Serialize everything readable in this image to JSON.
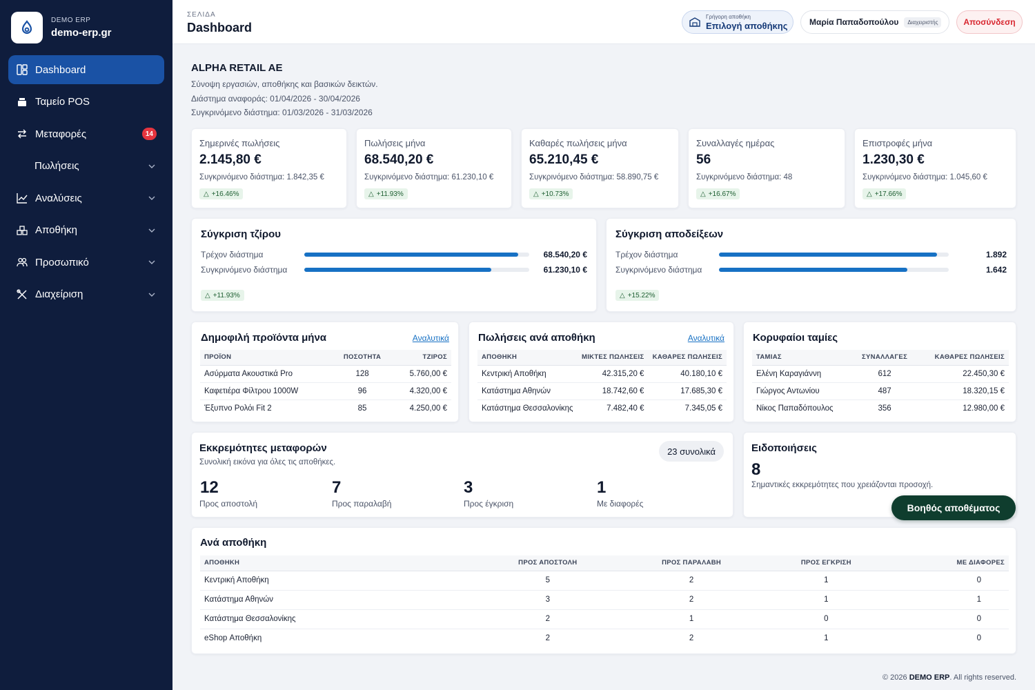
{
  "brand": {
    "small": "DEMO ERP",
    "name": "demo-erp.gr"
  },
  "sidebar": {
    "items": [
      {
        "label": "Dashboard",
        "icon": "dashboard-icon",
        "active": true
      },
      {
        "label": "Ταμείο POS",
        "icon": "cash-register-icon"
      },
      {
        "label": "Μεταφορές",
        "icon": "transfer-icon",
        "badge": "14"
      },
      {
        "label": "Πωλήσεις",
        "icon": "",
        "chevron": true
      },
      {
        "label": "Αναλύσεις",
        "icon": "chart-line-icon",
        "chevron": true
      },
      {
        "label": "Αποθήκη",
        "icon": "boxes-icon",
        "chevron": true
      },
      {
        "label": "Προσωπικό",
        "icon": "people-icon",
        "chevron": true
      },
      {
        "label": "Διαχείριση",
        "icon": "tools-icon",
        "chevron": true
      }
    ]
  },
  "header": {
    "crumb": "ΣΕΛΙΔΑ",
    "title": "Dashboard",
    "warehouse_small": "Γρήγορη αποθήκη",
    "warehouse_big": "Επιλογή αποθήκης",
    "user_name": "Μαρία Παπαδοπούλου",
    "user_role": "Διαχειριστής",
    "logout": "Αποσύνδεση"
  },
  "company": {
    "name": "ALPHA RETAIL AE",
    "subtitle": "Σύνοψη εργασιών, αποθήκης και βασικών δεικτών.",
    "period": "Διάστημα αναφοράς: 01/04/2026 - 30/04/2026",
    "compare": "Συγκρινόμενο διάστημα: 01/03/2026 - 31/03/2026"
  },
  "kpis": [
    {
      "label": "Σημερινές πωλήσεις",
      "value": "2.145,80 €",
      "cmp": "Συγκρινόμενο διάστημα: 1.842,35 €",
      "delta": "+16.46%"
    },
    {
      "label": "Πωλήσεις μήνα",
      "value": "68.540,20 €",
      "cmp": "Συγκρινόμενο διάστημα: 61.230,10 €",
      "delta": "+11.93%"
    },
    {
      "label": "Καθαρές πωλήσεις μήνα",
      "value": "65.210,45 €",
      "cmp": "Συγκρινόμενο διάστημα: 58.890,75 €",
      "delta": "+10.73%"
    },
    {
      "label": "Συναλλαγές ημέρας",
      "value": "56",
      "cmp": "Συγκρινόμενο διάστημα: 48",
      "delta": "+16.67%"
    },
    {
      "label": "Επιστροφές μήνα",
      "value": "1.230,30 €",
      "cmp": "Συγκρινόμενο διάστημα: 1.045,60 €",
      "delta": "+17.66%"
    }
  ],
  "turnover": {
    "title": "Σύγκριση τζίρου",
    "rows": [
      {
        "label": "Τρέχον διάστημα",
        "value": "68.540,20 €",
        "fraction": 0.95
      },
      {
        "label": "Συγκρινόμενο διάστημα",
        "value": "61.230,10 €",
        "fraction": 0.83
      }
    ],
    "delta": "+11.93%"
  },
  "receipts": {
    "title": "Σύγκριση αποδείξεων",
    "rows": [
      {
        "label": "Τρέχον διάστημα",
        "value": "1.892",
        "fraction": 0.95
      },
      {
        "label": "Συγκρινόμενο διάστημα",
        "value": "1.642",
        "fraction": 0.82
      }
    ],
    "delta": "+15.22%"
  },
  "top_products": {
    "title": "Δημοφιλή προϊόντα μήνα",
    "link": "Αναλυτικά",
    "headers": [
      "ΠΡΟΪΟΝ",
      "ΠΟΣΟΤΗΤΑ",
      "ΤΖΙΡΟΣ"
    ],
    "rows": [
      [
        "Ασύρματα Ακουστικά Pro",
        "128",
        "5.760,00 €"
      ],
      [
        "Καφετιέρα Φίλτρου 1000W",
        "96",
        "4.320,00 €"
      ],
      [
        "Έξυπνο Ρολόι Fit 2",
        "85",
        "4.250,00 €"
      ]
    ]
  },
  "sales_by_wh": {
    "title": "Πωλήσεις ανά αποθήκη",
    "link": "Αναλυτικά",
    "headers": [
      "ΑΠΟΘΗΚΗ",
      "ΜΙΚΤΕΣ ΠΩΛΗΣΕΙΣ",
      "ΚΑΘΑΡΕΣ ΠΩΛΗΣΕΙΣ"
    ],
    "rows": [
      [
        "Κεντρική Αποθήκη",
        "42.315,20 €",
        "40.180,10 €"
      ],
      [
        "Κατάστημα Αθηνών",
        "18.742,60 €",
        "17.685,30 €"
      ],
      [
        "Κατάστημα Θεσσαλονίκης",
        "7.482,40 €",
        "7.345,05 €"
      ]
    ]
  },
  "cashiers": {
    "title": "Κορυφαίοι ταμίες",
    "headers": [
      "ΤΑΜΙΑΣ",
      "ΣΥΝΑΛΛΑΓΕΣ",
      "ΚΑΘΑΡΕΣ ΠΩΛΗΣΕΙΣ"
    ],
    "rows": [
      [
        "Ελένη Καραγιάννη",
        "612",
        "22.450,30 €"
      ],
      [
        "Γιώργος Αντωνίου",
        "487",
        "18.320,15 €"
      ],
      [
        "Νίκος Παπαδόπουλος",
        "356",
        "12.980,00 €"
      ]
    ]
  },
  "pending": {
    "title": "Εκκρεμότητες μεταφορών",
    "subtitle": "Συνολική εικόνα για όλες τις αποθήκες.",
    "total": "23 συνολικά",
    "items": [
      {
        "num": "12",
        "label": "Προς αποστολή"
      },
      {
        "num": "7",
        "label": "Προς παραλαβή"
      },
      {
        "num": "3",
        "label": "Προς έγκριση"
      },
      {
        "num": "1",
        "label": "Με διαφορές"
      }
    ]
  },
  "notifications": {
    "title": "Ειδοποιήσεις",
    "count": "8",
    "text": "Σημαντικές εκκρεμότητες που χρειάζονται προσοχή.",
    "assistant": "Βοηθός αποθέματος"
  },
  "per_wh": {
    "title": "Ανά αποθήκη",
    "headers": [
      "ΑΠΟΘΗΚΗ",
      "ΠΡΟΣ ΑΠΟΣΤΟΛΗ",
      "ΠΡΟΣ ΠΑΡΑΛΑΒΗ",
      "ΠΡΟΣ ΕΓΚΡΙΣΗ",
      "ΜΕ ΔΙΑΦΟΡΕΣ"
    ],
    "rows": [
      [
        "Κεντρική Αποθήκη",
        "5",
        "2",
        "1",
        "0"
      ],
      [
        "Κατάστημα Αθηνών",
        "3",
        "2",
        "1",
        "1"
      ],
      [
        "Κατάστημα Θεσσαλονίκης",
        "2",
        "1",
        "0",
        "0"
      ],
      [
        "eShop Αποθήκη",
        "2",
        "2",
        "1",
        "0"
      ]
    ]
  },
  "footer": {
    "prefix": "© 2026",
    "brand": "DEMO ERP",
    "suffix": ". All rights reserved."
  },
  "colors": {
    "sidebar": "#0f1d3d",
    "active": "#1a52a5",
    "accent": "#1771c4",
    "danger": "#d8262f",
    "assistant": "#0f3d2e"
  }
}
